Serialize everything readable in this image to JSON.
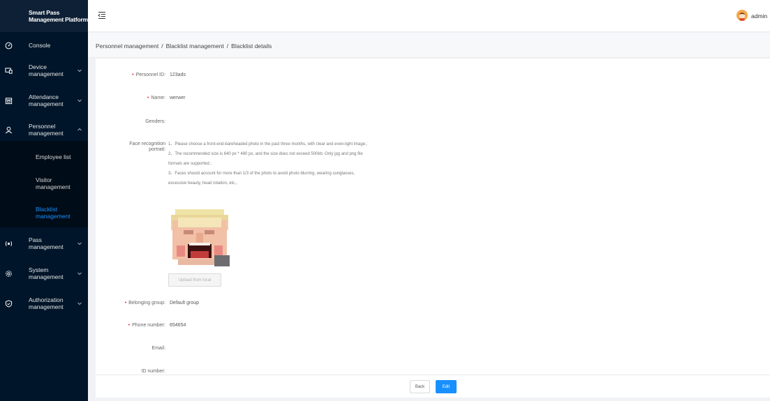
{
  "app": {
    "title": "Smart Pass\nManagement Platform"
  },
  "sidebar": {
    "items": [
      {
        "label": "Console",
        "icon": "console-icon"
      },
      {
        "label": "Device\nmanagement",
        "icon": "device-icon"
      },
      {
        "label": "Attendance\nmanagement",
        "icon": "calendar-icon"
      },
      {
        "label": "Personnel\nmanagement",
        "icon": "personnel-icon"
      },
      {
        "label": "Pass\nmanagement",
        "icon": "pass-icon"
      },
      {
        "label": "System\nmanagement",
        "icon": "gear-icon"
      },
      {
        "label": "Authorization\nmanagement",
        "icon": "shield-check-icon"
      }
    ],
    "sub_items": [
      {
        "label": "Employee list"
      },
      {
        "label": "Visitor\nmanagement"
      },
      {
        "label": "Blacklist\nmanagement",
        "active": true
      }
    ],
    "active_color": "#1890ff",
    "background": "#001529"
  },
  "header": {
    "username": "admin"
  },
  "breadcrumb": {
    "items": [
      "Personnel management",
      "Blacklist management",
      "Blacklist details"
    ],
    "separator": "/"
  },
  "form": {
    "personnel_id": {
      "label": "Personnel ID:",
      "value": "123ads",
      "required": true
    },
    "name": {
      "label": "Name:",
      "value": "werwer",
      "required": true
    },
    "genders": {
      "label": "Genders:",
      "value": ""
    },
    "face": {
      "label": "Face recognition\nportrait:",
      "hints": [
        "1、Please choose a front-end-bareheaded photo in the past three months, with clear and even-light image.;",
        "2、The recommended size is 640 px * 480 px, and the size does not exceed 500kb. Only jpg and png file formats are supported.;",
        "3、Faces should account for more than 1/3 of the photo to avoid photo blurring, wearing sunglasses, excessive beauty, head rotation, etc.,"
      ],
      "upload_label": "Upload from local"
    },
    "group": {
      "label": "Belonging group:",
      "value": "Default group",
      "required": true
    },
    "phone": {
      "label": "Phone number:",
      "value": "654654",
      "required": true
    },
    "email": {
      "label": "Email:",
      "value": ""
    },
    "id_number": {
      "label": "ID number:",
      "value": ""
    }
  },
  "footer": {
    "back_label": "Back",
    "edit_label": "Edit",
    "primary_color": "#1890ff"
  }
}
